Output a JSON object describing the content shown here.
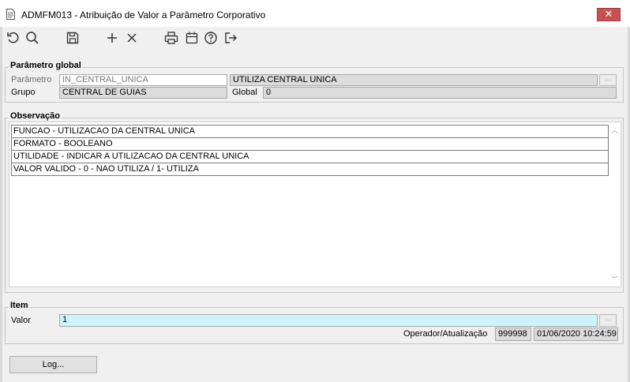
{
  "window": {
    "title": "ADMFM013 - Atribuição de Valor a Parâmetro Corporativo",
    "close_glyph": "✕"
  },
  "toolbar": {
    "icons": [
      "undo-icon",
      "search-icon",
      "save-icon",
      "add-icon",
      "delete-icon",
      "print-icon",
      "calendar-icon",
      "help-icon",
      "exit-icon"
    ]
  },
  "parametro_global": {
    "legend": "Parâmetro global",
    "parametro_label": "Parâmetro",
    "parametro_value": "IN_CENTRAL_UNICA",
    "descricao_value": "UTILIZA CENTRAL UNICA",
    "grupo_label": "Grupo",
    "grupo_value": "CENTRAL DE GUIAS",
    "global_label": "Global",
    "global_value": "0"
  },
  "observacao": {
    "legend": "Observação",
    "lines": [
      "FUNCAO - UTILIZACAO DA CENTRAL UNICA",
      "FORMATO - BOOLEANO",
      "UTILIDADE - INDICAR A UTILIZACAO DA CENTRAL UNICA",
      "VALOR VALIDO - 0 - NAO UTILIZA / 1- UTILIZA"
    ]
  },
  "item": {
    "legend": "Item",
    "valor_label": "Valor",
    "valor_value": "1",
    "operador_label": "Operador/Atualização",
    "operador_value": "999998",
    "atualizacao_value": "01/06/2020 10:24:59"
  },
  "log_button": "Log...",
  "colors": {
    "close_red": "#c75050",
    "valor_field": "#ccf4fa",
    "readonly_field": "#dcdcdc"
  }
}
